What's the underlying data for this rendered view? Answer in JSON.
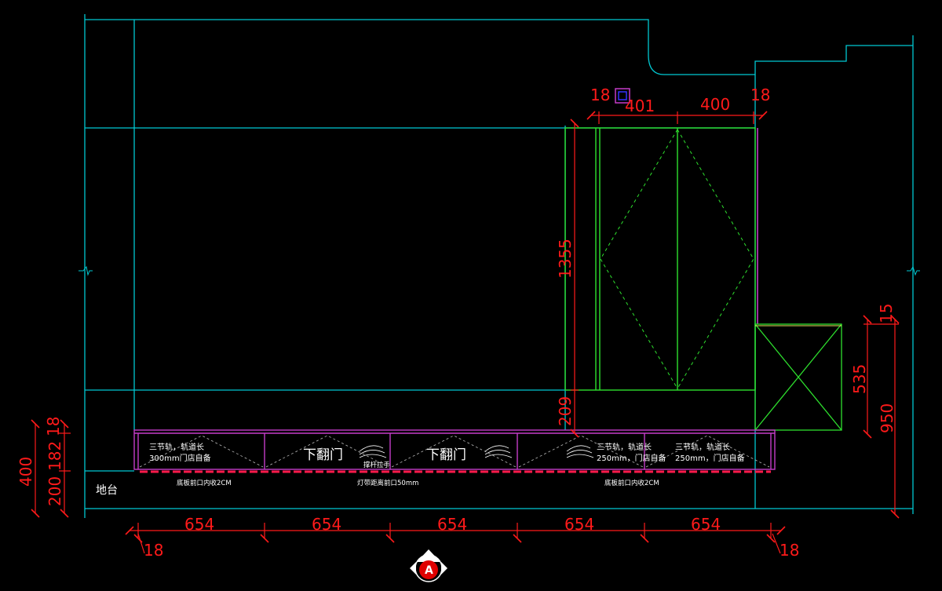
{
  "colors": {
    "background": "#000000",
    "wall": "#00c8d2",
    "cabinet": "#2ee02e",
    "panel": "#c43cc8",
    "dimension": "#ff1a1a",
    "text": "#ffffff"
  },
  "dimensions": {
    "top_left_thk": "18",
    "top_door_1": "401",
    "top_door_2": "400",
    "top_right_thk": "18",
    "tall_height": "1355",
    "tall_gap": "209",
    "right_top": "15",
    "right_box": "535",
    "right_total": "950",
    "left_panel_thk": "18",
    "left_cabinet": "182",
    "left_base": "200",
    "left_total": "400",
    "bottom_seg_1": "654",
    "bottom_seg_2": "654",
    "bottom_seg_3": "654",
    "bottom_seg_4": "654",
    "bottom_seg_5": "654",
    "bottom_left_thk": "18",
    "bottom_right_thk": "18"
  },
  "cabinet_notes": {
    "unit1_line1": "三节轨，轨道长",
    "unit1_line2": "300mm门店自备",
    "unit2_label": "下翻门",
    "unit3_label": "下翻门",
    "unit4_line1": "三节轨，轨道长",
    "unit4_line2": "250mm，门店自备",
    "unit5_line1": "三节轨，轨道长",
    "unit5_line2": "250mm，门店自备",
    "hardware_note": "撑杆拉手"
  },
  "floor_notes": {
    "left": "底板前口内收2CM",
    "center": "灯带距离前口50mm",
    "right": "底板前口内收2CM"
  },
  "platform_label": "地台",
  "compass_label": "A"
}
